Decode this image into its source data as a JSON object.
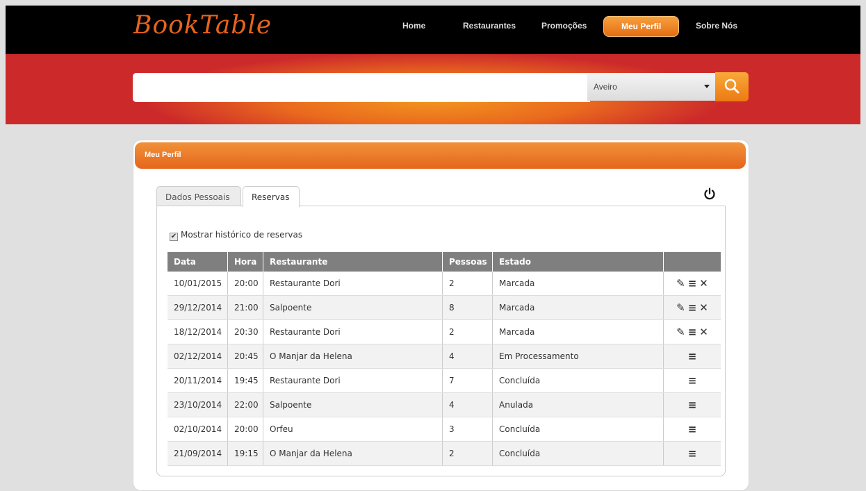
{
  "logo": "BookTable",
  "nav": [
    "Home",
    "Restaurantes",
    "Promoções",
    "Meu Perfil",
    "Sobre Nós"
  ],
  "search": {
    "value": "",
    "city": "Aveiro"
  },
  "panel": {
    "title": "Meu Perfil"
  },
  "tabs": [
    "Dados Pessoais",
    "Reservas"
  ],
  "history_label": "Mostrar histórico de reservas",
  "table": {
    "headers": [
      "Data",
      "Hora",
      "Restaurante",
      "Pessoas",
      "Estado",
      ""
    ],
    "rows": [
      [
        "10/01/2015",
        "20:00",
        "Restaurante Dori",
        "2",
        "Marcada"
      ],
      [
        "29/12/2014",
        "21:00",
        "Salpoente",
        "8",
        "Marcada"
      ],
      [
        "18/12/2014",
        "20:30",
        "Restaurante Dori",
        "2",
        "Marcada"
      ],
      [
        "02/12/2014",
        "20:45",
        "O Manjar da Helena",
        "4",
        "Em Processamento"
      ],
      [
        "20/11/2014",
        "19:45",
        "Restaurante Dori",
        "7",
        "Concluída"
      ],
      [
        "23/10/2014",
        "22:00",
        "Salpoente",
        "4",
        "Anulada"
      ],
      [
        "02/10/2014",
        "20:00",
        "Orfeu",
        "3",
        "Concluída"
      ],
      [
        "21/09/2014",
        "19:15",
        "O Manjar da Helena",
        "2",
        "Concluída"
      ]
    ],
    "editable_rows": 3
  },
  "colors": {
    "accent": "#e8641c",
    "header": "#7f7f7f"
  }
}
